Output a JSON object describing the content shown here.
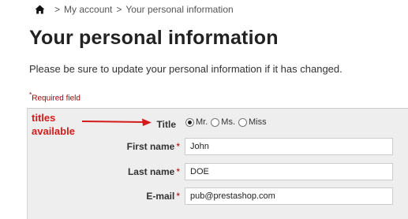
{
  "breadcrumb": {
    "separator": ">",
    "items": [
      "My account",
      "Your personal information"
    ]
  },
  "page": {
    "title": "Your personal information",
    "intro": "Please be sure to update your personal information if it has changed.",
    "required_note": "Required field",
    "required_star": "*"
  },
  "annotation": {
    "line1": "titles",
    "line2": "available",
    "color": "#d21c1c"
  },
  "form": {
    "title_label": "Title",
    "title_options": [
      {
        "label": "Mr.",
        "checked": true
      },
      {
        "label": "Ms.",
        "checked": false
      },
      {
        "label": "Miss",
        "checked": false
      }
    ],
    "first_name": {
      "label": "First name",
      "value": "John"
    },
    "last_name": {
      "label": "Last name",
      "value": "DOE"
    },
    "email": {
      "label": "E-mail",
      "value": "pub@prestashop.com"
    }
  },
  "icons": {
    "home": "home-icon"
  }
}
